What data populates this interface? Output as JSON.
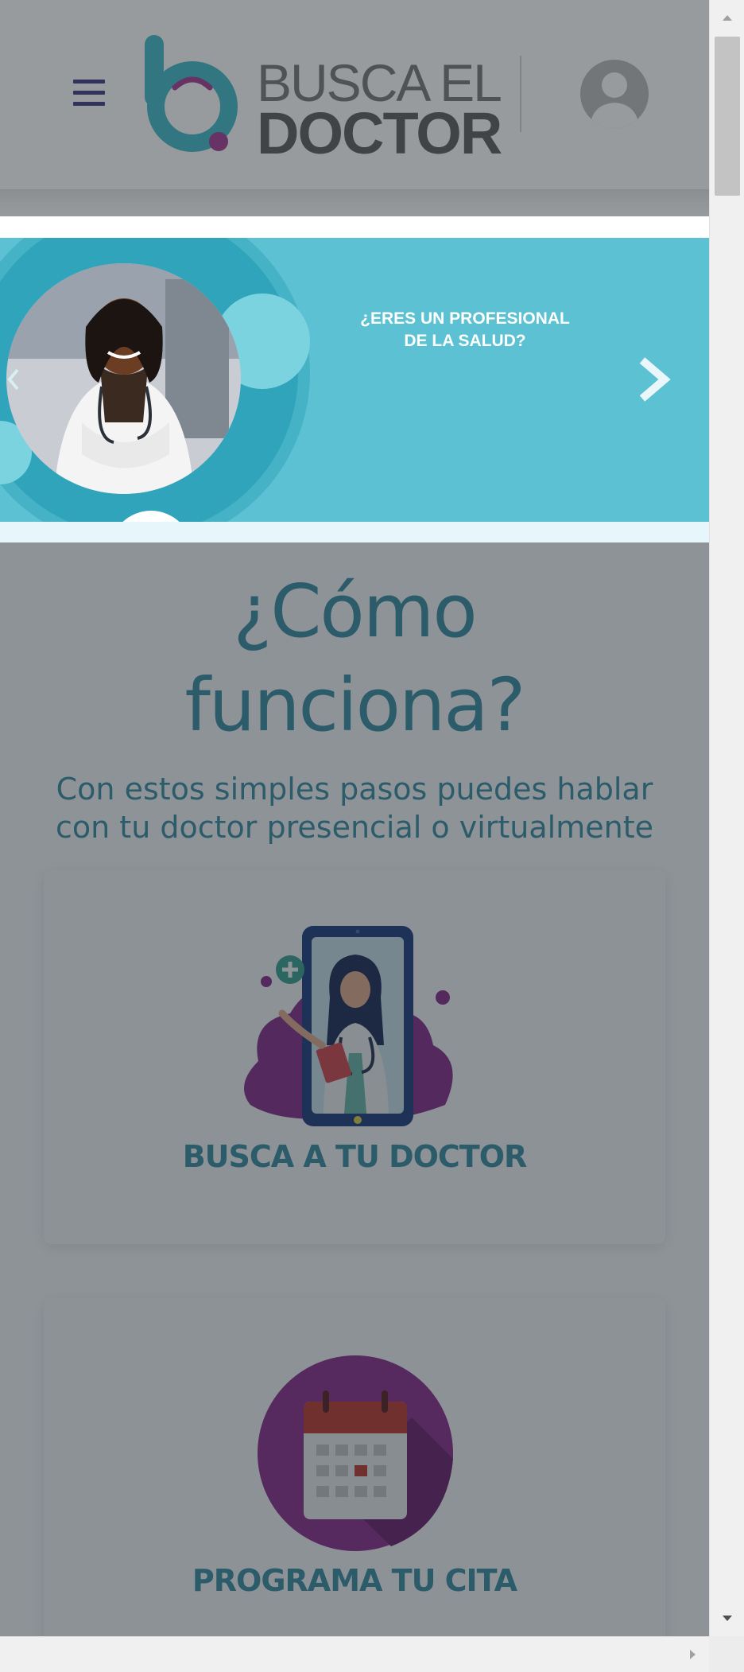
{
  "header": {
    "brand_line1": "BUSCA EL",
    "brand_line2": "DOCTOR",
    "menu_icon": "hamburger-icon",
    "profile_icon": "user-avatar-icon"
  },
  "banner": {
    "line1": "¿ERES UN PROFESIONAL",
    "line2": "DE LA SALUD?",
    "next_icon": "chevron-right-icon",
    "prev_icon": "chevron-left-icon"
  },
  "how_it_works": {
    "title_line1": "¿Cómo",
    "title_line2": "funciona?",
    "subtitle_line1": "Con estos simples pasos puedes hablar",
    "subtitle_line2": "con tu doctor presencial o virtualmente",
    "steps": [
      {
        "label": "BUSCA A TU DOCTOR",
        "icon": "doctor-phone-icon"
      },
      {
        "label": "PROGRAMA TU CITA",
        "icon": "calendar-icon"
      }
    ]
  },
  "colors": {
    "accent_teal": "#3a8fa3",
    "banner_teal": "#5cc1d2",
    "menu_navy": "#2a2d7c",
    "logo_purple": "#9c2a8a"
  }
}
